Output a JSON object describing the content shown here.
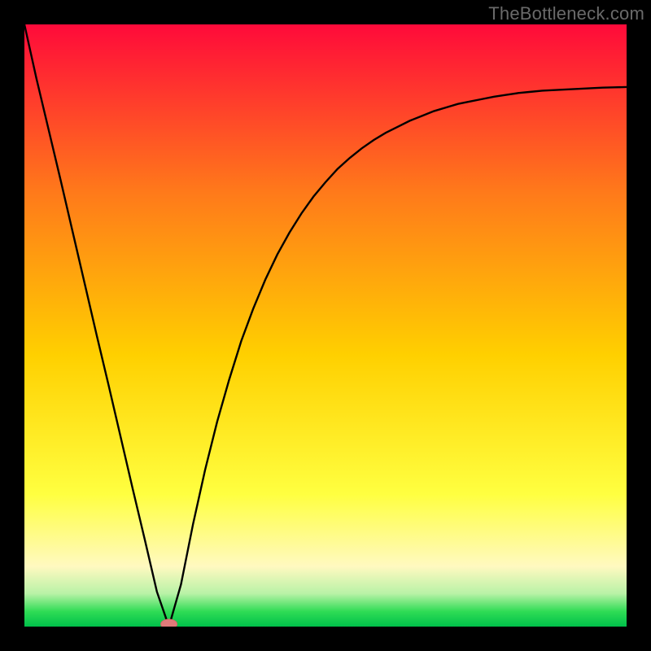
{
  "watermark": "TheBottleneck.com",
  "colors": {
    "bg_black": "#000000",
    "curve": "#000000",
    "marker_fill": "#e07a7a",
    "marker_stroke": "#d46a6a",
    "grad_top": "#ff0a3a",
    "grad_mid1": "#ff7a1a",
    "grad_mid2": "#ffd000",
    "grad_mid3": "#ffff40",
    "grad_bottom_band": "#fff9c0",
    "grad_green1": "#b9f2a7",
    "grad_green2": "#2fdc55",
    "grad_green3": "#00c04a"
  },
  "chart_data": {
    "type": "line",
    "title": "",
    "xlabel": "",
    "ylabel": "",
    "xlim": [
      0,
      100
    ],
    "ylim": [
      0,
      100
    ],
    "x": [
      0,
      2,
      4,
      6,
      8,
      10,
      12,
      14,
      16,
      18,
      20,
      22,
      24,
      26,
      28,
      30,
      32,
      34,
      36,
      38,
      40,
      42,
      44,
      46,
      48,
      50,
      52,
      54,
      56,
      58,
      60,
      62,
      64,
      66,
      68,
      70,
      72,
      74,
      76,
      78,
      80,
      82,
      84,
      86,
      88,
      90,
      92,
      94,
      96,
      98,
      100
    ],
    "series": [
      {
        "name": "bottleneck-curve",
        "values": [
          100,
          91,
          82.6,
          74.2,
          65.6,
          57,
          48.4,
          40,
          31.4,
          22.8,
          14.4,
          5.8,
          0,
          7,
          17,
          26,
          34,
          41,
          47.4,
          52.8,
          57.6,
          61.8,
          65.4,
          68.6,
          71.4,
          73.8,
          76,
          77.8,
          79.4,
          80.8,
          82,
          83,
          84,
          84.8,
          85.6,
          86.2,
          86.8,
          87.2,
          87.6,
          88,
          88.3,
          88.6,
          88.8,
          89,
          89.1,
          89.2,
          89.3,
          89.4,
          89.5,
          89.55,
          89.6
        ]
      }
    ],
    "markers": [
      {
        "x": 24,
        "y": 0,
        "name": "optimal-point"
      }
    ]
  }
}
